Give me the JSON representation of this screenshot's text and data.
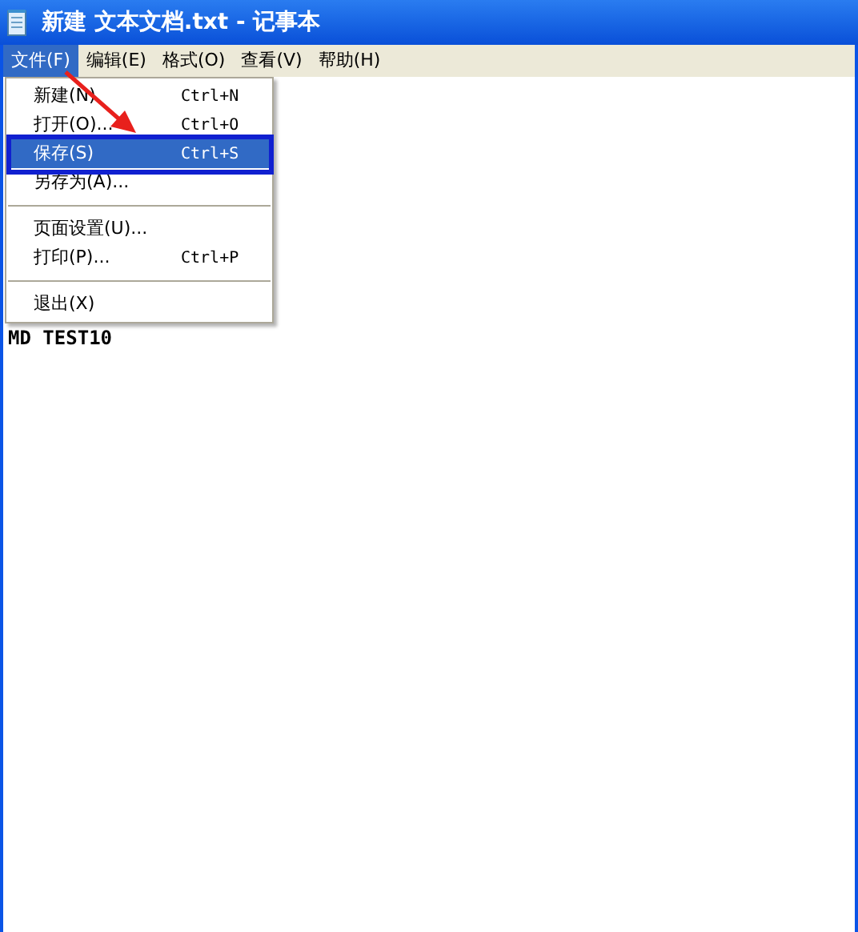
{
  "window": {
    "title": "新建 文本文档.txt - 记事本"
  },
  "menu_bar": [
    {
      "label": "文件(F)",
      "selected": true
    },
    {
      "label": "编辑(E)",
      "selected": false
    },
    {
      "label": "格式(O)",
      "selected": false
    },
    {
      "label": "查看(V)",
      "selected": false
    },
    {
      "label": "帮助(H)",
      "selected": false
    }
  ],
  "file_menu": [
    {
      "kind": "item",
      "label": "新建(N)",
      "shortcut": "Ctrl+N",
      "selected": false
    },
    {
      "kind": "item",
      "label": "打开(O)...",
      "shortcut": "Ctrl+O",
      "selected": false
    },
    {
      "kind": "item",
      "label": "保存(S)",
      "shortcut": "Ctrl+S",
      "selected": true
    },
    {
      "kind": "item",
      "label": "另存为(A)...",
      "selected": false
    },
    {
      "kind": "separator"
    },
    {
      "kind": "item",
      "label": "页面设置(U)...",
      "selected": false
    },
    {
      "kind": "item",
      "label": "打印(P)...",
      "shortcut": "Ctrl+P",
      "selected": false
    },
    {
      "kind": "separator"
    },
    {
      "kind": "item",
      "label": "退出(X)",
      "selected": false
    }
  ],
  "document": {
    "text": "MD TEST10"
  }
}
